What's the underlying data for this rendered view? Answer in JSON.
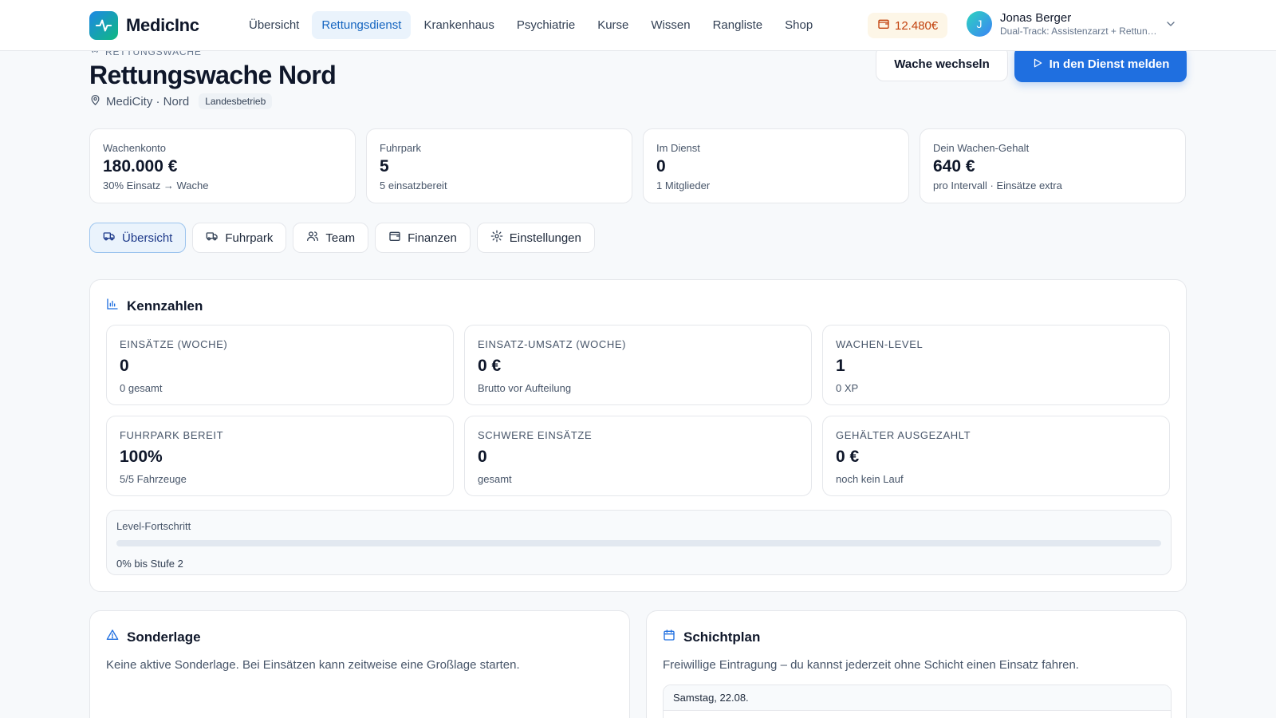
{
  "nav": {
    "brand": "MedicInc",
    "items": [
      {
        "label": "Übersicht",
        "active": false
      },
      {
        "label": "Rettungsdienst",
        "active": true
      },
      {
        "label": "Krankenhaus",
        "active": false
      },
      {
        "label": "Psychiatrie",
        "active": false
      },
      {
        "label": "Kurse",
        "active": false
      },
      {
        "label": "Wissen",
        "active": false
      },
      {
        "label": "Rangliste",
        "active": false
      },
      {
        "label": "Shop",
        "active": false
      }
    ],
    "wallet": "12.480€",
    "user": {
      "initial": "J",
      "name": "Jonas Berger",
      "subtitle": "Dual-Track: Assistenzarzt + Rettung..."
    }
  },
  "header": {
    "eyebrow": "Rettungswache",
    "title": "Rettungswache Nord",
    "location": "MediCity · Nord",
    "badge": "Landesbetrieb",
    "switch_label": "Wache wechseln",
    "primary_label": "In den Dienst melden"
  },
  "stats": [
    {
      "label": "Wachenkonto",
      "value": "180.000 €",
      "sub": "30% Einsatz → Wache"
    },
    {
      "label": "Fuhrpark",
      "value": "5",
      "sub": "5 einsatzbereit"
    },
    {
      "label": "Im Dienst",
      "value": "0",
      "sub": "1 Mitglieder"
    },
    {
      "label": "Dein Wachen-Gehalt",
      "value": "640 €",
      "sub": "pro Intervall · Einsätze extra"
    }
  ],
  "tabs": [
    {
      "label": "Übersicht",
      "icon": "truck-icon",
      "active": true
    },
    {
      "label": "Fuhrpark",
      "icon": "truck-icon",
      "active": false
    },
    {
      "label": "Team",
      "icon": "users-icon",
      "active": false
    },
    {
      "label": "Finanzen",
      "icon": "wallet-icon",
      "active": false
    },
    {
      "label": "Einstellungen",
      "icon": "gear-icon",
      "active": false
    }
  ],
  "kennzahlen": {
    "title": "Kennzahlen",
    "cards": [
      {
        "label": "Einsätze (Woche)",
        "value": "0",
        "sub": "0 gesamt"
      },
      {
        "label": "Einsatz-Umsatz (Woche)",
        "value": "0 €",
        "sub": "Brutto vor Aufteilung"
      },
      {
        "label": "Wachen-Level",
        "value": "1",
        "sub": "0 XP"
      },
      {
        "label": "Fuhrpark bereit",
        "value": "100%",
        "sub": "5/5 Fahrzeuge"
      },
      {
        "label": "Schwere Einsätze",
        "value": "0",
        "sub": "gesamt"
      },
      {
        "label": "Gehälter ausgezahlt",
        "value": "0 €",
        "sub": "noch kein Lauf"
      }
    ],
    "progress": {
      "label": "Level-Fortschritt",
      "percent": 0,
      "sub": "0% bis Stufe 2"
    }
  },
  "sonderlage": {
    "title": "Sonderlage",
    "text": "Keine aktive Sonderlage. Bei Einsätzen kann zeitweise eine Großlage starten."
  },
  "schichtplan": {
    "title": "Schichtplan",
    "text": "Freiwillige Eintragung – du kannst jederzeit ohne Schicht einen Einsatz fahren.",
    "day": "Samstag, 22.08."
  },
  "colors": {
    "accent": "#1f6fe0",
    "accent_soft": "#eaf3fc",
    "wallet": "#c2410c"
  }
}
